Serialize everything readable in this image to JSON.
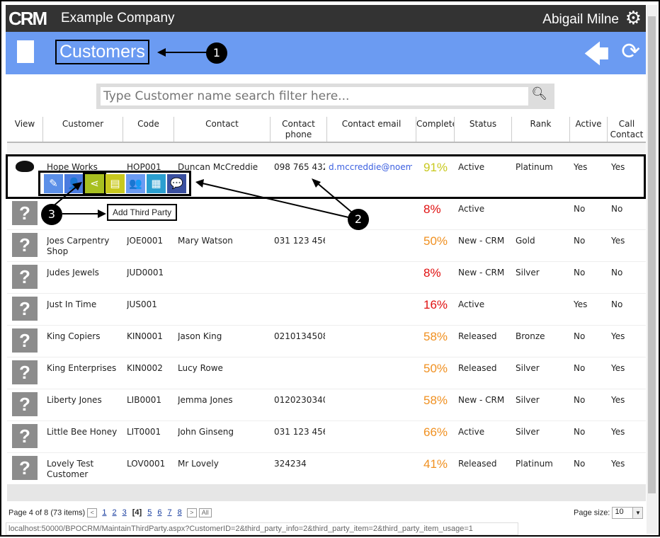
{
  "topbar": {
    "logo": "CRM",
    "company": "Example Company",
    "user": "Abigail Milne",
    "icon": "gear-icon"
  },
  "header": {
    "title": "Customers",
    "icons": [
      "building-icon",
      "back-arrow-icon",
      "refresh-icon"
    ]
  },
  "search": {
    "placeholder": "Type Customer name search filter here..."
  },
  "columns": [
    "View",
    "Customer",
    "Code",
    "Contact",
    "Contact phone",
    "Contact email",
    "Complete",
    "Status",
    "Rank",
    "Active",
    "Call Contact"
  ],
  "rows": [
    {
      "customer": "Hope Works",
      "code": "HOP001",
      "contact": "Duncan McCreddie",
      "phone": "098 765 432",
      "email": "d.mccreddie@noem",
      "complete": "91%",
      "status": "Active",
      "rank": "Platinum",
      "active": "Yes",
      "call": "Yes"
    },
    {
      "customer": "",
      "code": "",
      "contact": "",
      "phone": "",
      "email": "",
      "complete": "8%",
      "status": "Active",
      "rank": "",
      "active": "No",
      "call": "No"
    },
    {
      "customer": "Joes Carpentry Shop",
      "code": "JOE0001",
      "contact": "Mary Watson",
      "phone": "031 123 456",
      "email": "",
      "complete": "50%",
      "status": "New - CRM",
      "rank": "Gold",
      "active": "No",
      "call": "Yes"
    },
    {
      "customer": "Judes Jewels",
      "code": "JUD0001",
      "contact": "",
      "phone": "",
      "email": "",
      "complete": "8%",
      "status": "New - CRM",
      "rank": "Silver",
      "active": "No",
      "call": "No"
    },
    {
      "customer": "Just In Time",
      "code": "JUS001",
      "contact": "",
      "phone": "",
      "email": "",
      "complete": "16%",
      "status": "Active",
      "rank": "",
      "active": "Yes",
      "call": "No"
    },
    {
      "customer": "King Copiers",
      "code": "KIN0001",
      "contact": "Jason King",
      "phone": "0210134508",
      "email": "",
      "complete": "58%",
      "status": "Released",
      "rank": "Bronze",
      "active": "No",
      "call": "Yes"
    },
    {
      "customer": "King Enterprises",
      "code": "KIN0002",
      "contact": "Lucy Rowe",
      "phone": "",
      "email": "",
      "complete": "50%",
      "status": "Released",
      "rank": "Silver",
      "active": "No",
      "call": "Yes"
    },
    {
      "customer": "Liberty Jones",
      "code": "LIB0001",
      "contact": "Jemma Jones",
      "phone": "0120230340",
      "email": "",
      "complete": "58%",
      "status": "New - CRM",
      "rank": "Silver",
      "active": "No",
      "call": "Yes"
    },
    {
      "customer": "Little Bee Honey",
      "code": "LIT0001",
      "contact": "John Ginseng",
      "phone": "031 123 456",
      "email": "",
      "complete": "66%",
      "status": "Active",
      "rank": "Silver",
      "active": "No",
      "call": "Yes"
    },
    {
      "customer": "Lovely Test Customer",
      "code": "LOV0001",
      "contact": "Mr Lovely",
      "phone": "324234",
      "email": "",
      "complete": "41%",
      "status": "Released",
      "rank": "Platinum",
      "active": "No",
      "call": "Yes"
    }
  ],
  "colors": {
    "topbar": "#333333",
    "header": "#6b9bf2",
    "pct_high": "#c8c81e",
    "pct_low": "#e01010",
    "pct_mid": "#f09020",
    "email": "#3b5fe0"
  },
  "row_actions": [
    {
      "icon": "edit-pencil-icon",
      "color": "#5b8fe8"
    },
    {
      "icon": "add-contact-icon",
      "color": "#4a7be0"
    },
    {
      "icon": "share-third-party-icon",
      "color": "#a8c020"
    },
    {
      "icon": "document-icon",
      "color": "#c8c81e"
    },
    {
      "icon": "contacts-icon",
      "color": "#6b9bf2"
    },
    {
      "icon": "calendar-icon",
      "color": "#2a9fd0"
    },
    {
      "icon": "chat-icon",
      "color": "#3a50a0"
    }
  ],
  "tooltip": "Add Third Party",
  "callouts": [
    "1",
    "2",
    "3"
  ],
  "pager": {
    "info": "Page 4 of 8 (73 items)",
    "pages": [
      "1",
      "2",
      "3",
      "[4]",
      "5",
      "6",
      "7",
      "8"
    ],
    "all": "All",
    "page_size_label": "Page size:",
    "page_size": "10"
  },
  "status_url": "localhost:50000/BPOCRM/MaintainThirdParty.aspx?CustomerID=2&third_party_info=2&third_party_item=2&third_party_item_usage=1"
}
